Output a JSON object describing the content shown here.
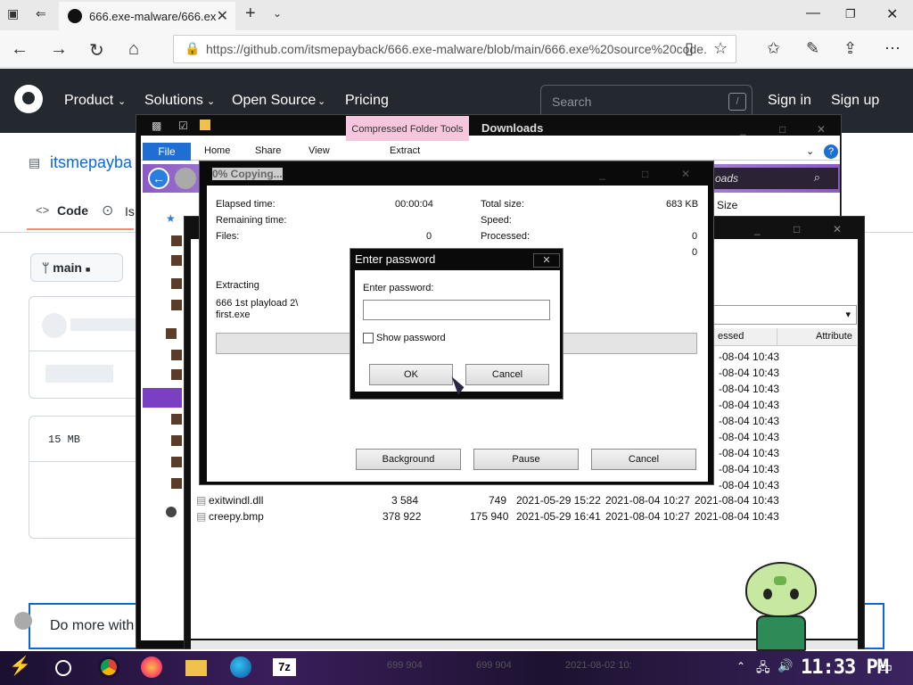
{
  "browser": {
    "tab_title": "666.exe-malware/666.ex",
    "url": "https://github.com/itsmepayback/666.exe-malware/blob/main/666.exe%20source%20code.",
    "new_tab": "+"
  },
  "github": {
    "nav": [
      "Product",
      "Solutions",
      "Open Source",
      "Pricing"
    ],
    "search_placeholder": "Search",
    "search_key": "/",
    "sign_in": "Sign in",
    "sign_up": "Sign up",
    "repo_owner": "itsmepayba",
    "code_tab": "Code",
    "issues_tab_partial": "Is",
    "branch": "main",
    "file_size": "15 MB",
    "banner": "Do more with"
  },
  "explorer": {
    "title": "Downloads",
    "contextual_tab": "Compressed Folder Tools",
    "ribbon_tabs": [
      "File",
      "Home",
      "Share",
      "View"
    ],
    "extract_tab": "Extract",
    "search_partial": "oads",
    "size_col": "Size"
  },
  "sevenzip": {
    "column_headers": {
      "accessed_partial": "essed",
      "attributes": "Attribute"
    },
    "accessed_times": [
      "-08-04 10:43",
      "-08-04 10:43",
      "-08-04 10:43",
      "-08-04 10:43",
      "-08-04 10:43",
      "-08-04 10:43",
      "-08-04 10:43",
      "-08-04 10:43",
      "-08-04 10:43"
    ],
    "files": [
      {
        "name": "exitwindl.dll",
        "size": "3 584",
        "packed": "749",
        "modified": "2021-05-29 15:22",
        "created": "2021-08-04 10:27",
        "accessed": "2021-08-04 10:43"
      },
      {
        "name": "creepy.bmp",
        "size": "378 922",
        "packed": "175 940",
        "modified": "2021-05-29 16:41",
        "created": "2021-08-04 10:27",
        "accessed": "2021-08-04 10:43"
      }
    ],
    "faint_row": {
      "size": "699 904",
      "packed": "699 904",
      "modified": "2021-08-02 10:"
    }
  },
  "copy_dialog": {
    "title": "0% Copying...",
    "elapsed_label": "Elapsed time:",
    "elapsed_value": "00:00:04",
    "remaining_label": "Remaining time:",
    "files_label": "Files:",
    "files_value": "0",
    "total_size_label": "Total size:",
    "total_size_value": "683 KB",
    "speed_label": "Speed:",
    "processed_label": "Processed:",
    "processed_value": "0",
    "extra_value": "0",
    "extracting_label": "Extracting",
    "extracting_path_1": "666 1st playload 2\\",
    "extracting_path_2": "first.exe",
    "background_btn": "Background",
    "pause_btn": "Pause",
    "cancel_btn": "Cancel",
    "progress_fraction": 0
  },
  "password_dialog": {
    "title": "Enter password",
    "prompt": "Enter password:",
    "value": "",
    "show_password": "Show password",
    "ok": "OK",
    "cancel": "Cancel"
  },
  "taskbar": {
    "app_7z": "7z",
    "time": "11:33 PM"
  }
}
